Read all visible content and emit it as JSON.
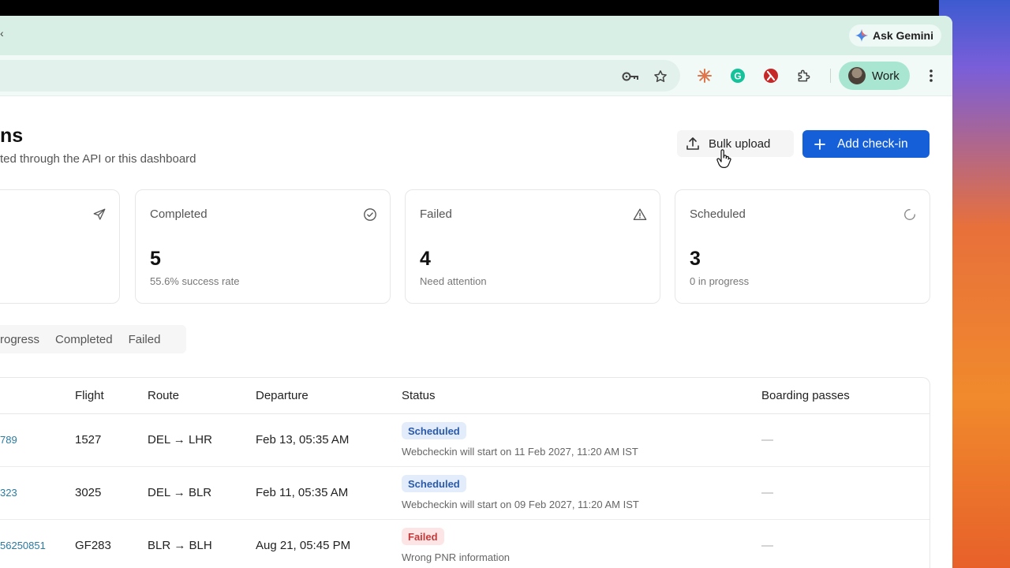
{
  "browser": {
    "tab_left_char": "‹",
    "ask_gemini": "Ask Gemini",
    "profile_label": "Work"
  },
  "page": {
    "title": "ns",
    "subtitle": "ted through the API or this dashboard",
    "bulk_upload": "Bulk upload",
    "add_checkin": "Add check-in"
  },
  "stats": [
    {
      "label": "Completed",
      "value": "5",
      "sub": "55.6% success rate",
      "icon": "check-circle-icon"
    },
    {
      "label": "Failed",
      "value": "4",
      "sub": "Need attention",
      "icon": "warning-icon"
    },
    {
      "label": "Scheduled",
      "value": "3",
      "sub": "0 in progress",
      "icon": "loading-icon"
    }
  ],
  "filters": [
    "rogress",
    "Completed",
    "Failed"
  ],
  "table": {
    "headers": {
      "flight": "Flight",
      "route": "Route",
      "departure": "Departure",
      "status": "Status",
      "boarding": "Boarding passes"
    },
    "rows": [
      {
        "pnr": "789",
        "flight": "1527",
        "route": "DEL → LHR",
        "departure": "Feb 13, 05:35 AM",
        "status": "Scheduled",
        "note": "Webcheckin will start on 11 Feb 2027, 11:20 AM IST",
        "boarding": "—"
      },
      {
        "pnr": "323",
        "flight": "3025",
        "route": "DEL → BLR",
        "departure": "Feb 11, 05:35 AM",
        "status": "Scheduled",
        "note": "Webcheckin will start on 09 Feb 2027, 11:20 AM IST",
        "boarding": "—"
      },
      {
        "pnr": "56250851",
        "flight": "GF283",
        "route": "BLR → BLH",
        "departure": "Aug 21, 05:45 PM",
        "status": "Failed",
        "note": "Wrong PNR information",
        "boarding": "—"
      }
    ]
  },
  "colors": {
    "primary": "#1560d9",
    "tabstrip": "#d8efe6",
    "profile": "#a8e6d2"
  }
}
